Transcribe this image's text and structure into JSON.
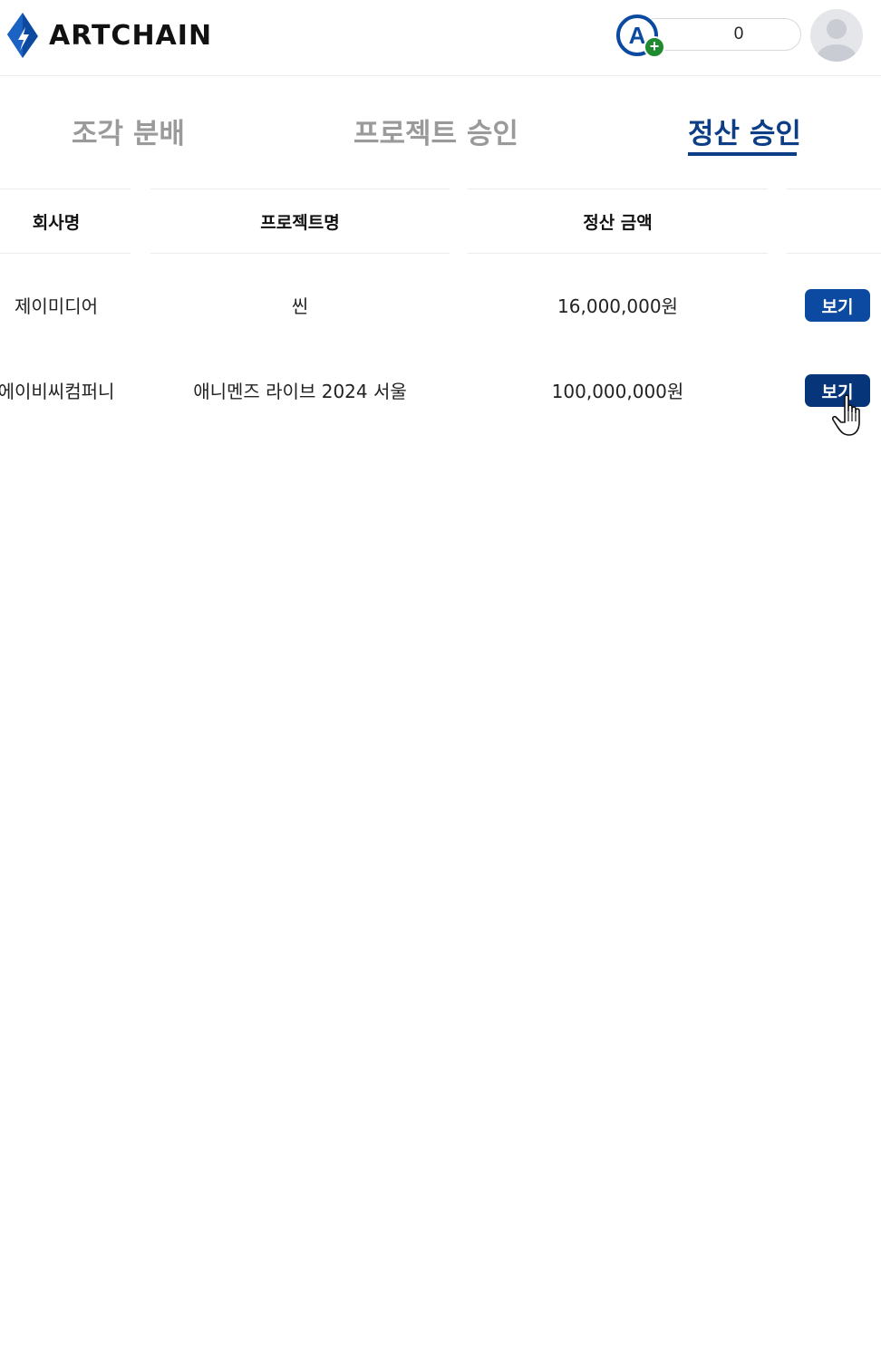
{
  "header": {
    "brand": "ARTCHAIN",
    "token_symbol": "A",
    "token_add": "+",
    "token_balance": "0",
    "colors": {
      "brand_blue": "#0b4aa0",
      "plus_green": "#1f8a2e"
    }
  },
  "tabs": [
    {
      "label": "조각 분배",
      "active": false
    },
    {
      "label": "프로젝트 승인",
      "active": false
    },
    {
      "label": "정산 승인",
      "active": true
    }
  ],
  "table": {
    "columns": [
      "회사명",
      "프로젝트명",
      "정산 금액",
      ""
    ],
    "rows": [
      {
        "company": "제이미디어",
        "project": "씬",
        "amount": "16,000,000원",
        "action": "보기"
      },
      {
        "company": "에이비씨컴퍼니",
        "project": "애니멘즈 라이브 2024 서울",
        "amount": "100,000,000원",
        "action": "보기"
      }
    ]
  },
  "icons": {
    "logo": "artchain-logo-icon",
    "token": "artchain-token-icon",
    "avatar": "user-avatar-icon",
    "cursor": "hand-pointer-cursor-icon"
  }
}
